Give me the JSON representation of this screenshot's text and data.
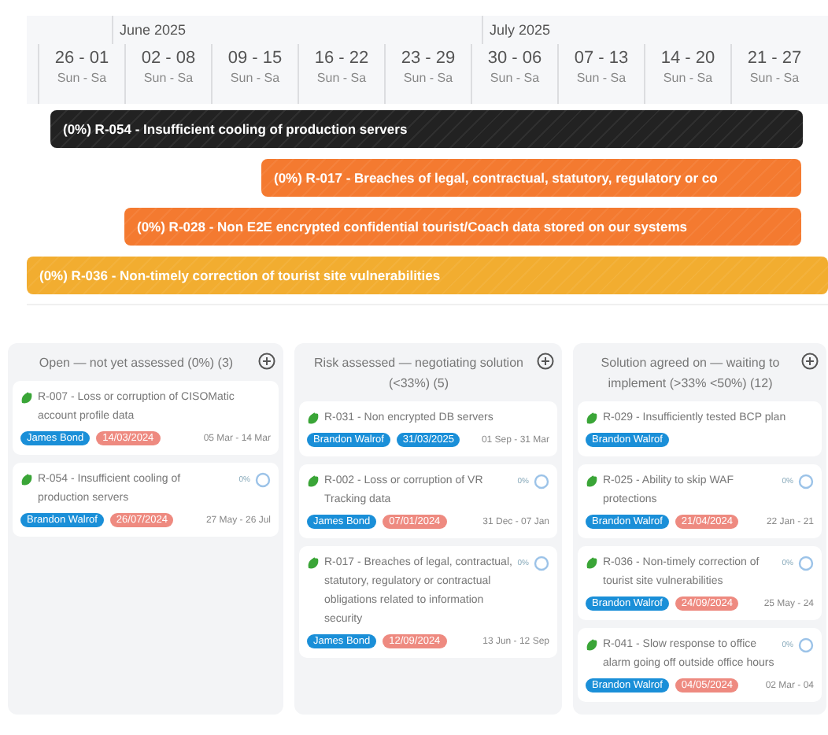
{
  "timeline": {
    "months": [
      "June 2025",
      "July 2025"
    ],
    "weeks": [
      {
        "range": "26 - 01",
        "days": "Sun - Sa"
      },
      {
        "range": "02 - 08",
        "days": "Sun - Sa"
      },
      {
        "range": "09 - 15",
        "days": "Sun - Sa"
      },
      {
        "range": "16 - 22",
        "days": "Sun - Sa"
      },
      {
        "range": "23 - 29",
        "days": "Sun - Sa"
      },
      {
        "range": "30 - 06",
        "days": "Sun - Sa"
      },
      {
        "range": "07 - 13",
        "days": "Sun - Sa"
      },
      {
        "range": "14 - 20",
        "days": "Sun - Sa"
      },
      {
        "range": "21 - 27",
        "days": "Sun - Sa"
      }
    ],
    "bars": [
      {
        "label": "(0%) R-054 - Insufficient cooling of production servers",
        "color": "#222222"
      },
      {
        "label": "(0%) R-017 - Breaches of legal, contractual, statutory, regulatory or co",
        "color": "#f47a30"
      },
      {
        "label": "(0%) R-028 - Non E2E encrypted confidential tourist/Coach data stored on our systems",
        "color": "#f47a30"
      },
      {
        "label": "(0%) R-036 - Non-timely correction of tourist site vulnerabilities",
        "color": "#f2ad30"
      }
    ]
  },
  "board": {
    "columns": [
      {
        "title": "Open — not yet assessed (0%) (3)",
        "cards": [
          {
            "title": "R-007 - Loss or corruption of CISOMatic account profile data",
            "owner": "James Bond",
            "due": "14/03/2024",
            "overdue": true,
            "dates": "05 Mar - 14 Mar"
          },
          {
            "title": "R-054 - Insufficient cooling of production servers",
            "progress": "0%",
            "owner": "Brandon Walrof",
            "due": "26/07/2024",
            "overdue": true,
            "dates": "27 May - 26 Jul"
          }
        ]
      },
      {
        "title": "Risk assessed — negotiating solution (<33%) (5)",
        "cards": [
          {
            "title": "R-031 - Non encrypted DB servers",
            "owner": "Brandon Walrof",
            "due": "31/03/2025",
            "overdue": false,
            "dates": "01 Sep - 31 Mar"
          },
          {
            "title": "R-002 - Loss or corruption of VR Tracking data",
            "progress": "0%",
            "owner": "James Bond",
            "due": "07/01/2024",
            "overdue": true,
            "dates": "31 Dec - 07 Jan"
          },
          {
            "title": "R-017 - Breaches of legal, contractual, statutory, regulatory or contractual obligations related to information security",
            "progress": "0%",
            "owner": "James Bond",
            "due": "12/09/2024",
            "overdue": true,
            "dates": "13 Jun - 12 Sep"
          }
        ]
      },
      {
        "title": "Solution agreed on — waiting to implement (>33% <50%) (12)",
        "cards": [
          {
            "title": "R-029 - Insufficiently tested BCP plan",
            "owner": "Brandon Walrof"
          },
          {
            "title": "R-025 - Ability to skip WAF protections",
            "progress": "0%",
            "owner": "Brandon Walrof",
            "due": "21/04/2024",
            "overdue": true,
            "dates": "22 Jan - 21"
          },
          {
            "title": "R-036 - Non-timely correction of tourist site vulnerabilities",
            "progress": "0%",
            "owner": "Brandon Walrof",
            "due": "24/09/2024",
            "overdue": true,
            "dates": "25 May - 24"
          },
          {
            "title": "R-041 - Slow response to office alarm going off outside office hours",
            "progress": "0%",
            "owner": "Brandon Walrof",
            "due": "04/05/2024",
            "overdue": true,
            "dates": "02 Mar - 04"
          }
        ]
      }
    ]
  }
}
